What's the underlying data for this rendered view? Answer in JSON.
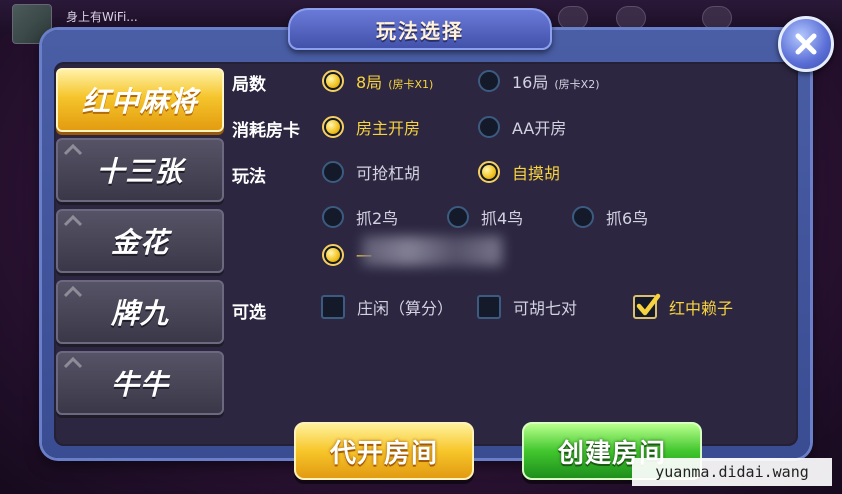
{
  "top": {
    "status_text": "身上有WiFi..."
  },
  "dialog": {
    "title": "玩法选择"
  },
  "tabs": [
    {
      "label": "红中麻将",
      "active": true
    },
    {
      "label": "十三张",
      "active": false
    },
    {
      "label": "金花",
      "active": false
    },
    {
      "label": "牌九",
      "active": false
    },
    {
      "label": "牛牛",
      "active": false
    }
  ],
  "rounds": {
    "label": "局数",
    "options": [
      {
        "text": "8局",
        "sub": "(房卡X1)",
        "selected": true
      },
      {
        "text": "16局",
        "sub": "(房卡X2)",
        "selected": false
      }
    ]
  },
  "card_cost": {
    "label": "消耗房卡",
    "options": [
      {
        "text": "房主开房",
        "selected": true
      },
      {
        "text": "AA开房",
        "selected": false
      }
    ]
  },
  "play_mode": {
    "label": "玩法",
    "options": [
      {
        "text": "可抢杠胡",
        "selected": false
      },
      {
        "text": "自摸胡",
        "selected": true
      }
    ],
    "birds": [
      {
        "text": "抓2鸟",
        "selected": false
      },
      {
        "text": "抓4鸟",
        "selected": false
      },
      {
        "text": "抓6鸟",
        "selected": false
      }
    ],
    "blurred_option": {
      "text": "一",
      "selected": true
    }
  },
  "optional": {
    "label": "可选",
    "options": [
      {
        "text": "庄闲（算分）",
        "checked": false
      },
      {
        "text": "可胡七对",
        "checked": false
      },
      {
        "text": "红中赖子",
        "checked": true
      }
    ]
  },
  "buttons": {
    "proxy_open": "代开房间",
    "create_room": "创建房间"
  },
  "watermark": "yuanma.didai.wang",
  "icons": {
    "close": "close-icon",
    "check": "checkmark-icon",
    "radio": "radio-dot-icon"
  },
  "colors": {
    "accent": "#f7d33e",
    "panel": "#3a4c92",
    "inner": "#2c2640"
  }
}
